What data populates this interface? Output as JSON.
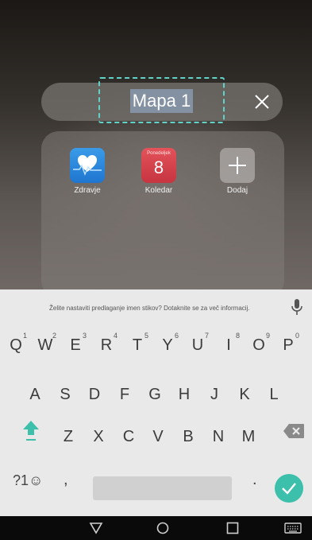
{
  "folder": {
    "name": "Mapa 1"
  },
  "apps": [
    {
      "label": "Zdravje",
      "icon": "health-heart-icon"
    },
    {
      "label": "Koledar",
      "icon": "calendar-icon",
      "day_name": "Ponedeljek",
      "day_number": "8"
    },
    {
      "label": "Dodaj",
      "icon": "plus-icon"
    }
  ],
  "keyboard": {
    "suggestion": "Želite nastaviti predlaganje imen stikov? Dotaknite se za več informacij.",
    "row1": [
      {
        "key": "Q",
        "hint": "1"
      },
      {
        "key": "W",
        "hint": "2"
      },
      {
        "key": "E",
        "hint": "3"
      },
      {
        "key": "R",
        "hint": "4"
      },
      {
        "key": "T",
        "hint": "5"
      },
      {
        "key": "Y",
        "hint": "6"
      },
      {
        "key": "U",
        "hint": "7"
      },
      {
        "key": "I",
        "hint": "8"
      },
      {
        "key": "O",
        "hint": "9"
      },
      {
        "key": "P",
        "hint": "0"
      }
    ],
    "row2": [
      "A",
      "S",
      "D",
      "F",
      "G",
      "H",
      "J",
      "K",
      "L"
    ],
    "row3": [
      "Z",
      "X",
      "C",
      "V",
      "B",
      "N",
      "M"
    ],
    "symbols_label": "?1☺",
    "comma": ",",
    "period": "."
  },
  "colors": {
    "accent": "#3cc0ac",
    "selection_border": "#5fd3c8"
  }
}
